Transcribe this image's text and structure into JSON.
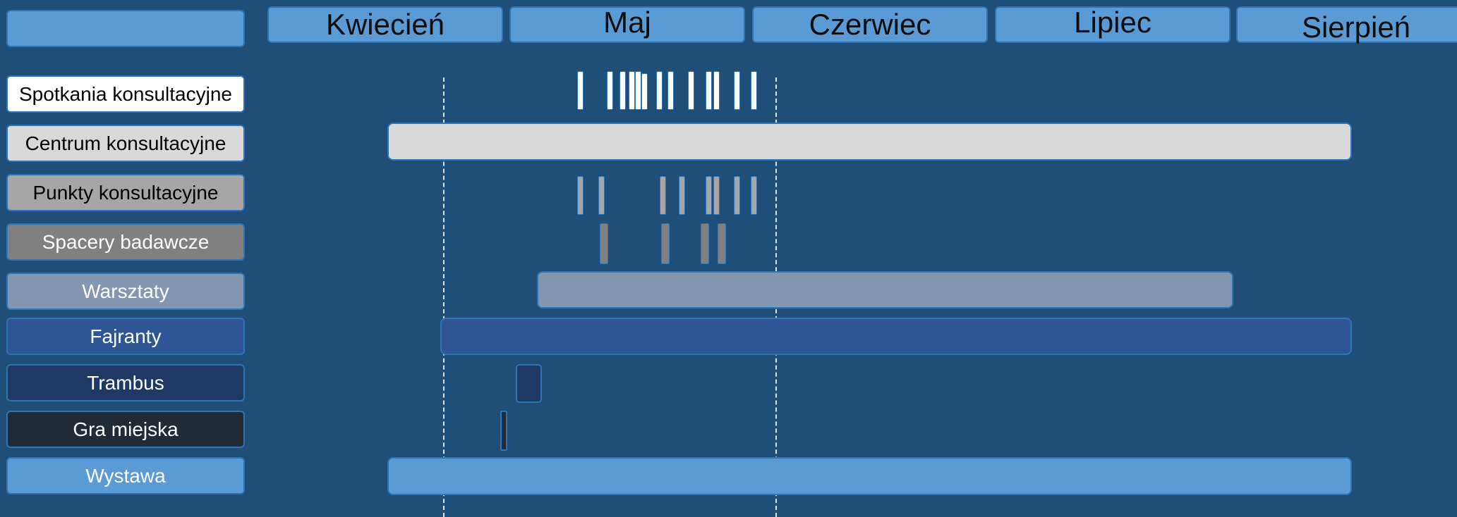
{
  "months": [
    "Kwiecień",
    "Maj",
    "Czerwiec",
    "Lipiec",
    "Sierpień"
  ],
  "rows": [
    {
      "label": "Spotkania konsultacyjne",
      "bg": "#ffffff",
      "fg": "#000000"
    },
    {
      "label": "Centrum konsultacyjne",
      "bg": "#d9d9d9",
      "fg": "#000000"
    },
    {
      "label": "Punkty  konsultacyjne",
      "bg": "#a6a6a6",
      "fg": "#000000"
    },
    {
      "label": "Spacery badawcze",
      "bg": "#808080",
      "fg": "#ffffff"
    },
    {
      "label": "Warsztaty",
      "bg": "#8497b0",
      "fg": "#ffffff"
    },
    {
      "label": "Fajranty",
      "bg": "#2f5597",
      "fg": "#ffffff"
    },
    {
      "label": "Trambus",
      "bg": "#203864",
      "fg": "#ffffff"
    },
    {
      "label": "Gra miejska",
      "bg": "#222a35",
      "fg": "#ffffff"
    },
    {
      "label": "Wystawa",
      "bg": "#5b9bd5",
      "fg": "#ffffff"
    }
  ],
  "colors": {
    "background": "#1f4e79",
    "accent": "#5b9bd5"
  }
}
